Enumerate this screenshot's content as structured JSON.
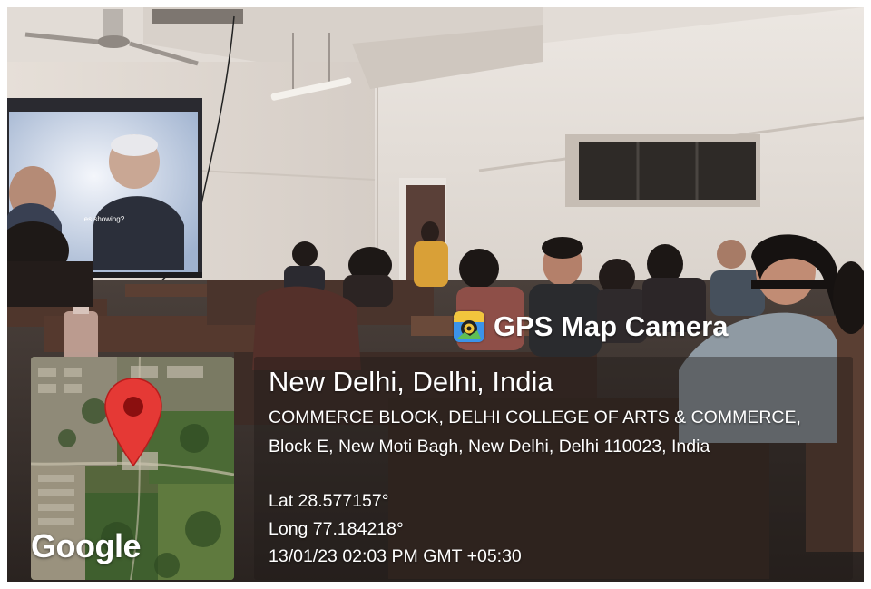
{
  "overlay": {
    "app_name": "GPS Map Camera",
    "app_icon": "map-pin-camera-icon",
    "location_title": "New Delhi, Delhi, India",
    "address": "COMMERCE BLOCK, DELHI COLLEGE OF ARTS & COMMERCE, Block E, New Moti Bagh, New Delhi, Delhi 110023, India",
    "latitude": "Lat 28.577157°",
    "longitude": "Long 77.184218°",
    "timestamp": "13/01/23 02:03 PM GMT +05:30"
  },
  "map": {
    "provider_logo": "Google",
    "marker_icon": "map-marker-icon",
    "marker_color": "#e53935"
  },
  "photo": {
    "scene": "classroom-with-projector-screen",
    "projector_subtitle": "...es showing?"
  }
}
